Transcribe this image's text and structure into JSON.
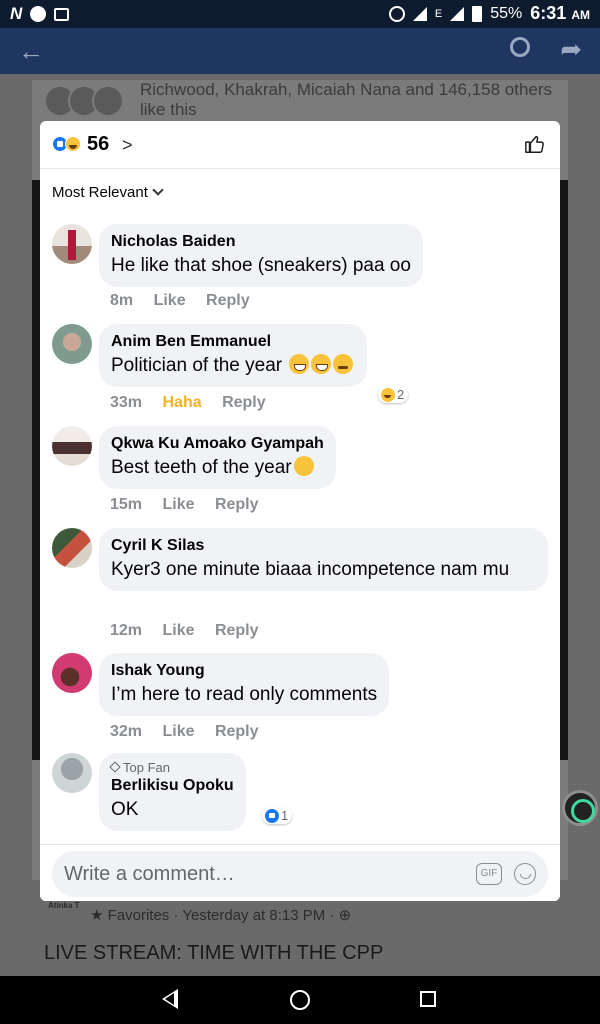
{
  "status_bar": {
    "app_icon": "N",
    "battery": "55%",
    "time": "6:31",
    "ampm": "AM",
    "network": "E"
  },
  "background": {
    "likes_text": "Richwood, Khakrah, Micaiah Nana and 146,158 others like this",
    "favorites": "Favorites · Yesterday at 8:13 PM ·",
    "post_title": "LIVE STREAM: TIME WITH THE CPP",
    "page_label": "Atinka T"
  },
  "dialog": {
    "reaction_count": "56",
    "sort_label": "Most Relevant",
    "comments": [
      {
        "name": "Nicholas Baiden",
        "text": "He like that shoe (sneakers) paa oo",
        "time": "8m",
        "like": "Like",
        "reply": "Reply"
      },
      {
        "name": "Anim Ben Emmanuel",
        "text": "Politician of the year",
        "emojis": [
          "grin",
          "grin",
          "rolling"
        ],
        "time": "33m",
        "like": "Haha",
        "reply": "Reply",
        "reactions": "2"
      },
      {
        "name": "Qkwa Ku Amoako Gyampah",
        "text": "Best teeth of the year",
        "time": "15m",
        "like": "Like",
        "reply": "Reply"
      },
      {
        "name": "Cyril K Silas",
        "text": "Kyer3 one minute biaaa incompetence nam mu",
        "time": "12m",
        "like": "Like",
        "reply": "Reply"
      },
      {
        "name": "Ishak Young",
        "text": "I’m here to read only comments",
        "time": "32m",
        "like": "Like",
        "reply": "Reply"
      },
      {
        "badge": "Top Fan",
        "name": "Berlikisu Opoku",
        "text": "OK",
        "reactions": "1"
      }
    ],
    "compose_placeholder": "Write a comment…",
    "gif_label": "GIF"
  },
  "colors": {
    "like_blue": "#1877f2",
    "haha_yellow": "#f7b125",
    "bubble_bg": "#f0f2f5",
    "meta_gray": "#8a8d91"
  },
  "icons": [
    "back-arrow-icon",
    "search-icon",
    "share-icon",
    "like-reaction-icon",
    "haha-reaction-icon",
    "thumbs-up-icon",
    "chevron-right-icon",
    "chevron-down-icon",
    "gif-icon",
    "emoji-icon",
    "top-fan-icon"
  ]
}
